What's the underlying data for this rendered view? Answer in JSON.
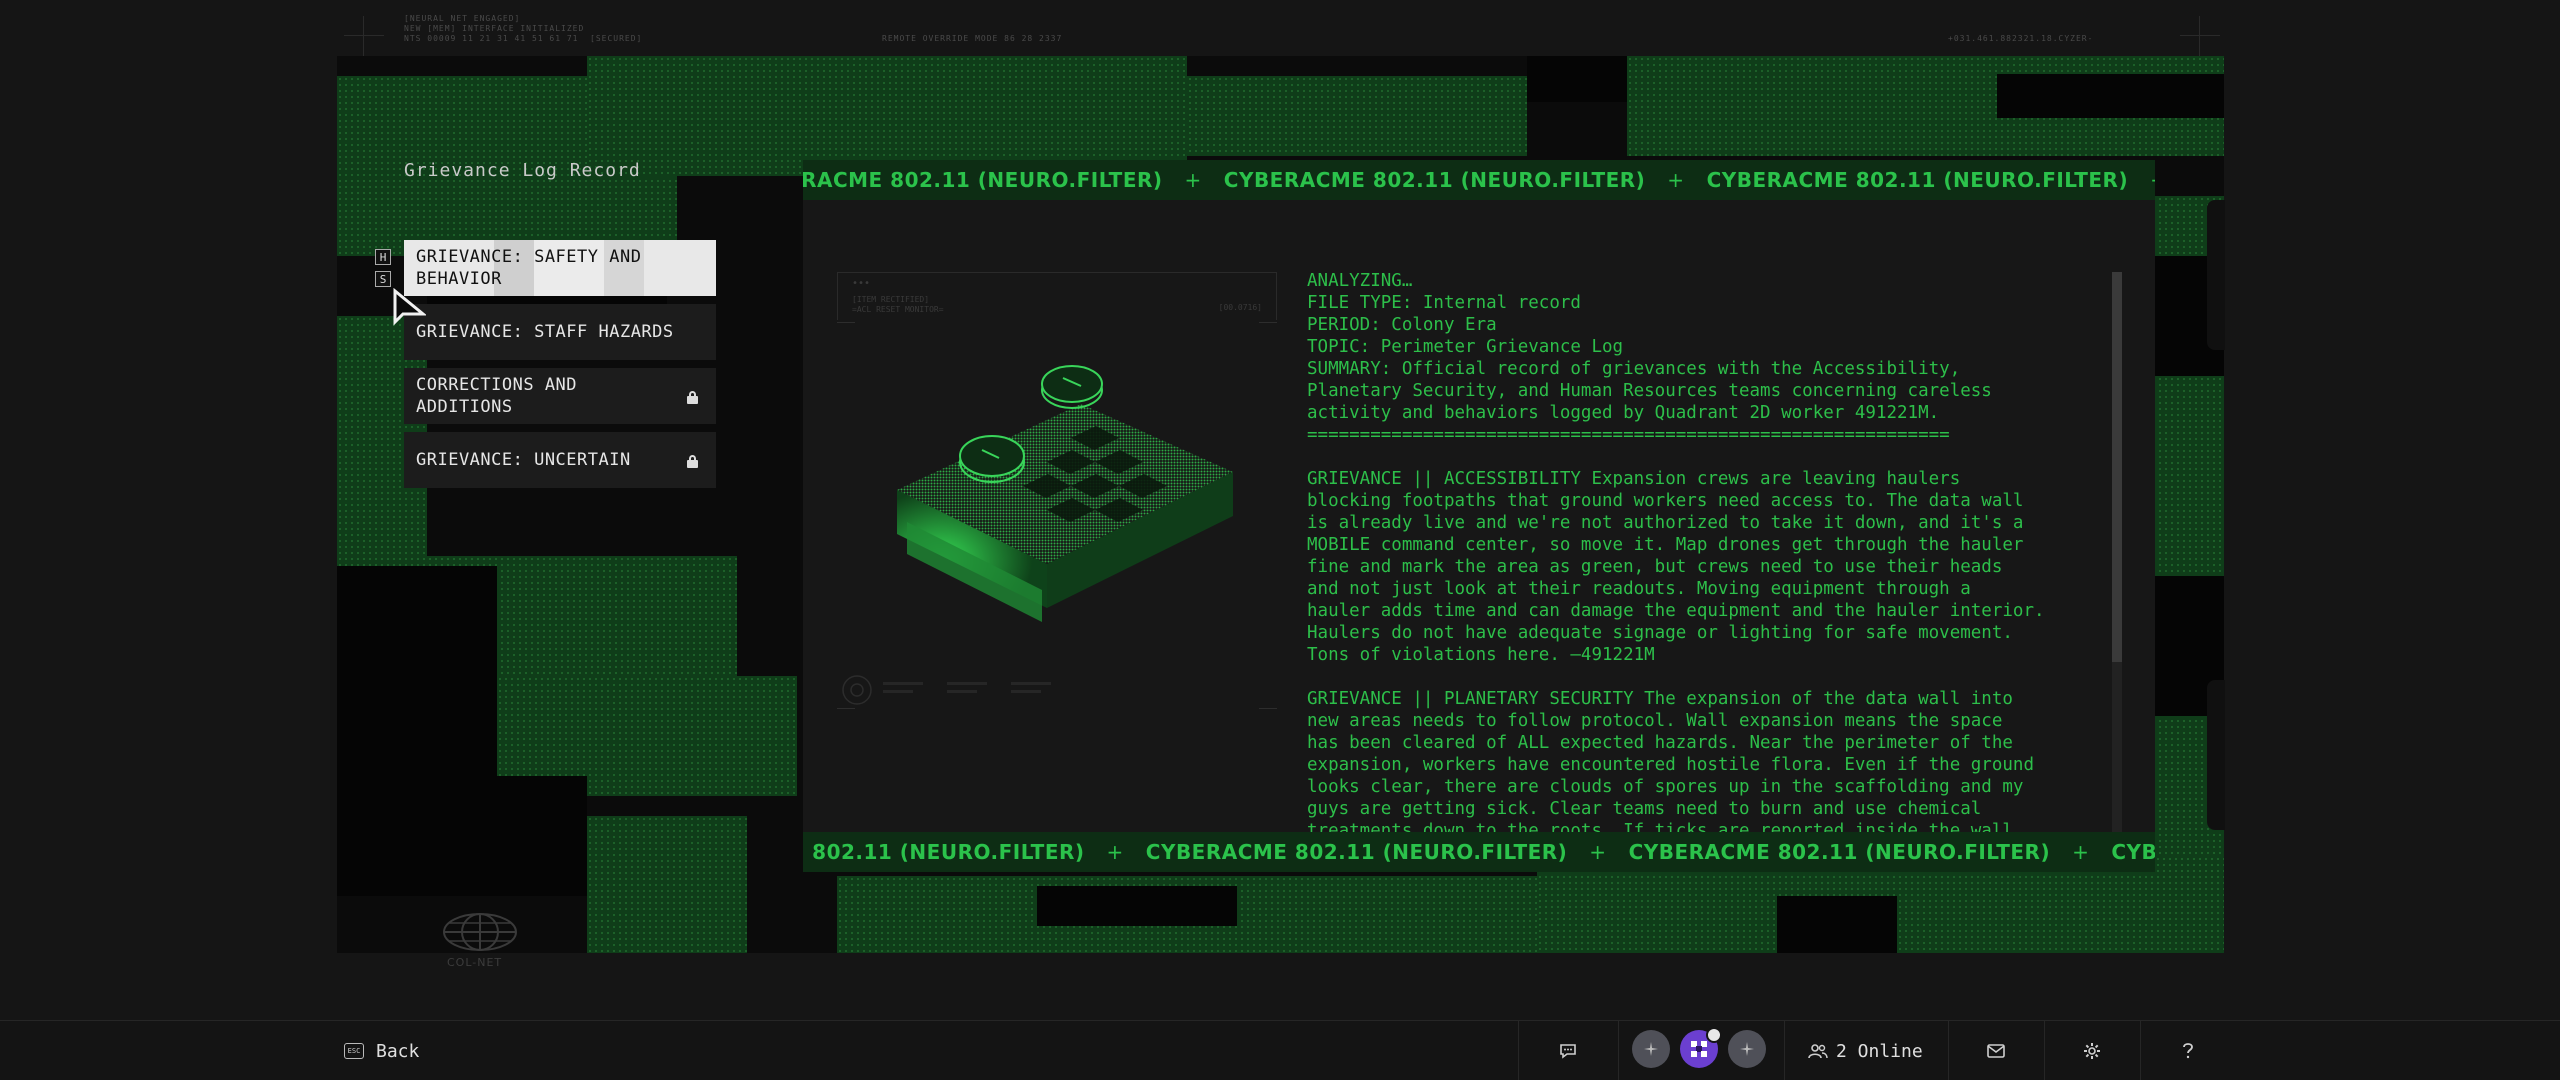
{
  "hud": {
    "top_left_1": "[NEURAL NET ENGAGED]",
    "top_left_2": "NEW [MEM] INTERFACE INITIALIZED",
    "top_left_3": "NTS 00009 11 21 31 41 51 61 71",
    "top_left_tag": "[SECURED]",
    "top_center": "REMOTE OVERRIDE MODE 86 28 2337",
    "top_right": "+031.461.882321.18.CYZER-"
  },
  "log": {
    "title": "Grievance Log Record",
    "hotkeys": {
      "up": "H",
      "down": "S"
    },
    "items": [
      {
        "label": "GRIEVANCE: SAFETY AND BEHAVIOR",
        "locked": false,
        "active": true
      },
      {
        "label": "GRIEVANCE: STAFF HAZARDS",
        "locked": false,
        "active": false
      },
      {
        "label": "CORRECTIONS AND ADDITIONS",
        "locked": true,
        "active": false
      },
      {
        "label": "GRIEVANCE: UNCERTAIN",
        "locked": true,
        "active": false
      }
    ]
  },
  "ticker": {
    "text": "CYBERACME 802.11 (NEURO.FILTER)",
    "separator": "+"
  },
  "viewer": {
    "header_dots": "•••",
    "header_small_1": "[ITEM RECTIFIED]",
    "header_small_2": "=ACL RESET MONITOR=",
    "header_small_right": "[00.0716]"
  },
  "record": {
    "text": "ANALYZING…\nFILE TYPE: Internal record\nPERIOD: Colony Era\nTOPIC: Perimeter Grievance Log\nSUMMARY: Official record of grievances with the Accessibility,\nPlanetary Security, and Human Resources teams concerning careless\nactivity and behaviors logged by Quadrant 2D worker 491221M.\n=============================================================\n\nGRIEVANCE || ACCESSIBILITY Expansion crews are leaving haulers\nblocking footpaths that ground workers need access to. The data wall\nis already live and we're not authorized to take it down, and it's a\nMOBILE command center, so move it. Map drones get through the hauler\nfine and mark the area as green, but crews need to use their heads\nand not just look at their readouts. Moving equipment through a\nhauler adds time and can damage the equipment and the hauler interior.\nHaulers do not have adequate signage or lighting for safe movement.\nTons of violations here. —491221M\n\nGRIEVANCE || PLANETARY SECURITY The expansion of the data wall into\nnew areas needs to follow protocol. Wall expansion means the space\nhas been cleared of ALL expected hazards. Near the perimeter of the\nexpansion, workers have encountered hostile flora. Even if the ground\nlooks clear, there are clouds of spores up in the scaffolding and my\nguys are getting sick. Clear teams need to burn and use chemical\ntreatments down to the roots. If ticks are reported inside the wall,\nthe last expansion ring needs to be FULLY SWEPT for nests. Grounds"
  },
  "brand": {
    "logo_text": "COL-NET"
  },
  "footer": {
    "back_key": "ESC",
    "back_label": "Back",
    "online_label": "2 Online"
  },
  "colors": {
    "accent_green": "#2bc24b",
    "ticker_bg": "#0d2d14",
    "avatar_purple": "#6b3fd0"
  }
}
